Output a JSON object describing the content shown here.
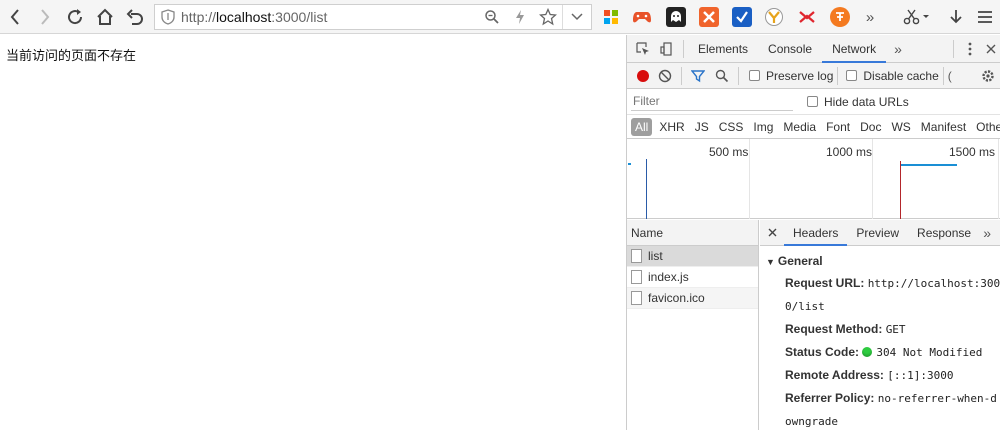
{
  "browser": {
    "url_prefix": "http://",
    "url_host": "localhost",
    "url_rest": ":3000/list"
  },
  "page": {
    "message": "当前访问的页面不存在"
  },
  "devtools": {
    "tabs": [
      "Elements",
      "Console",
      "Network"
    ],
    "active_tab": "Network",
    "preserve_log": "Preserve log",
    "disable_cache": "Disable cache",
    "filter_placeholder": "Filter",
    "hide_data_urls": "Hide data URLs",
    "types": [
      "All",
      "XHR",
      "JS",
      "CSS",
      "Img",
      "Media",
      "Font",
      "Doc",
      "WS",
      "Manifest",
      "Other"
    ],
    "timeline_labels": [
      "500 ms",
      "1000 ms",
      "1500 ms"
    ],
    "name_header": "Name",
    "requests": [
      "list",
      "index.js",
      "favicon.ico"
    ],
    "detail_tabs": [
      "Headers",
      "Preview",
      "Response"
    ],
    "general_title": "General",
    "general": {
      "request_url_key": "Request URL:",
      "request_url_val_1": "http://localhost:300",
      "request_url_val_2": "0/list",
      "method_key": "Request Method:",
      "method_val": "GET",
      "status_key": "Status Code:",
      "status_val": "304 Not Modified",
      "remote_key": "Remote Address:",
      "remote_val": "[::1]:3000",
      "referrer_key": "Referrer Policy:",
      "referrer_val_1": "no-referrer-when-d",
      "referrer_val_2": "owngrade"
    }
  },
  "colors": {
    "accent": "#3879d9",
    "record": "#d80d0d",
    "status_ok": "#2ecc40",
    "annotation_arrow": "#d62020"
  }
}
